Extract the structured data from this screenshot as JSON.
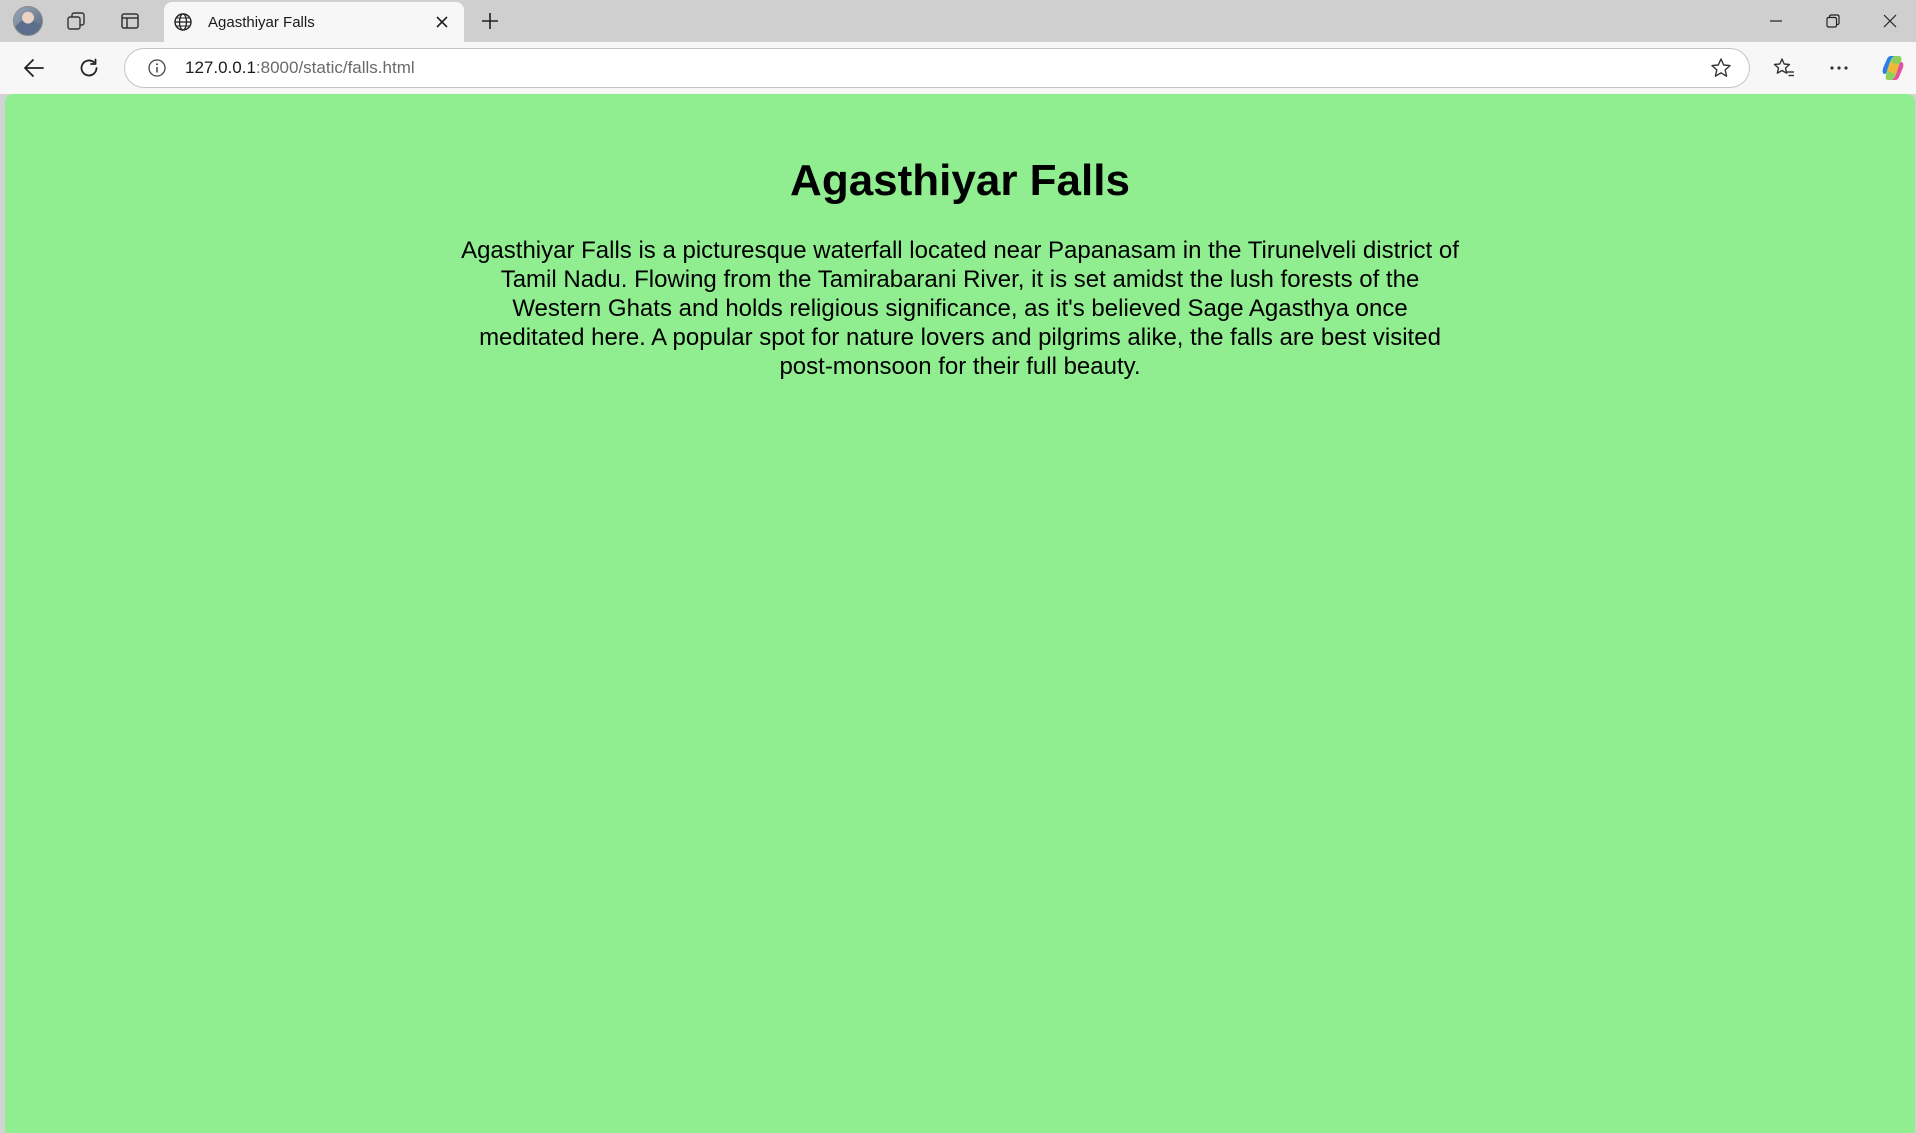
{
  "browser": {
    "tab": {
      "title": "Agasthiyar Falls",
      "favicon": "globe-icon"
    },
    "address_bar": {
      "url_host": "127.0.0.1",
      "url_rest": ":8000/static/falls.html"
    },
    "icons": {
      "profile": "profile-avatar",
      "workspaces": "workspaces-icon",
      "vertical_tabs": "vertical-tabs-icon",
      "new_tab": "plus-icon",
      "minimize": "minimize-icon",
      "restore": "restore-icon",
      "close": "close-icon",
      "back": "back-arrow-icon",
      "refresh": "refresh-icon",
      "site_info": "info-icon",
      "favorite": "star-icon",
      "favorites": "favorites-icon",
      "more": "more-icon",
      "copilot": "copilot-icon"
    }
  },
  "page": {
    "background_color": "#90ee90",
    "heading": "Agasthiyar Falls",
    "description": "Agasthiyar Falls is a picturesque waterfall located near Papanasam in the Tirunelveli district of Tamil Nadu. Flowing from the Tamirabarani River, it is set amidst the lush forests of the Western Ghats and holds religious significance, as it's believed Sage Agasthya once meditated here. A popular spot for nature lovers and pilgrims alike, the falls are best visited post-monsoon for their full beauty."
  }
}
